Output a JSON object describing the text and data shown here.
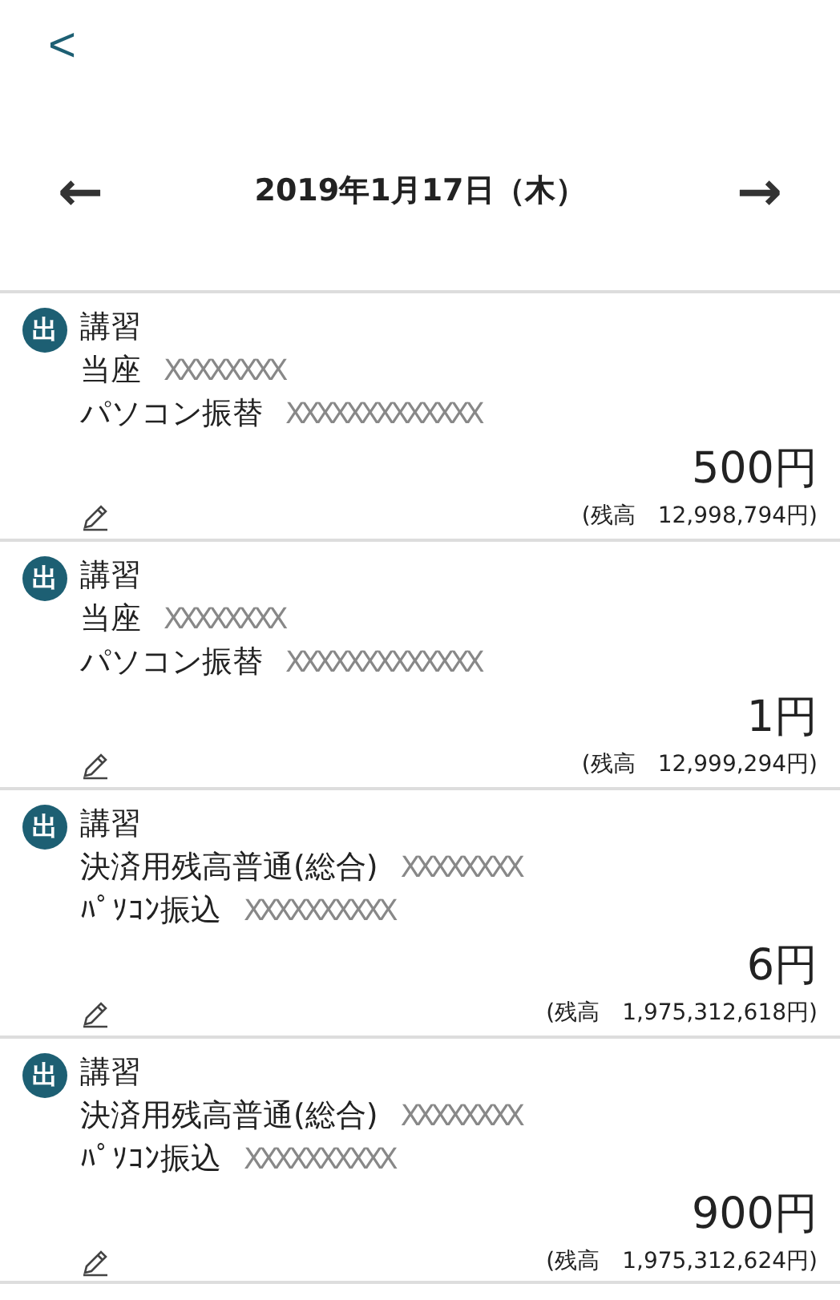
{
  "header": {
    "back": "<"
  },
  "date_nav": {
    "prev": "←",
    "date": "2019年1月17日（木）",
    "next": "→"
  },
  "transactions": [
    {
      "type_badge": "出",
      "title": "講習",
      "account": "当座",
      "account_mask": "XXXXXXXX",
      "description": "パソコン振替",
      "description_mask": "XXXXXXXXXXXXX",
      "amount": "500円",
      "balance_label": "(残高",
      "balance": "12,998,794円)"
    },
    {
      "type_badge": "出",
      "title": "講習",
      "account": "当座",
      "account_mask": "XXXXXXXX",
      "description": "パソコン振替",
      "description_mask": "XXXXXXXXXXXXX",
      "amount": "1円",
      "balance_label": "(残高",
      "balance": "12,999,294円)"
    },
    {
      "type_badge": "出",
      "title": "講習",
      "account": "決済用残高普通(総合)",
      "account_mask": "XXXXXXXX",
      "description": "ﾊﾟｿｺﾝ振込",
      "description_mask": "XXXXXXXXXX",
      "amount": "6円",
      "balance_label": "(残高",
      "balance": "1,975,312,618円)"
    },
    {
      "type_badge": "出",
      "title": "講習",
      "account": "決済用残高普通(総合)",
      "account_mask": "XXXXXXXX",
      "description": "ﾊﾟｿｺﾝ振込",
      "description_mask": "XXXXXXXXXX",
      "amount": "900円",
      "balance_label": "(残高",
      "balance": "1,975,312,624円)"
    }
  ]
}
